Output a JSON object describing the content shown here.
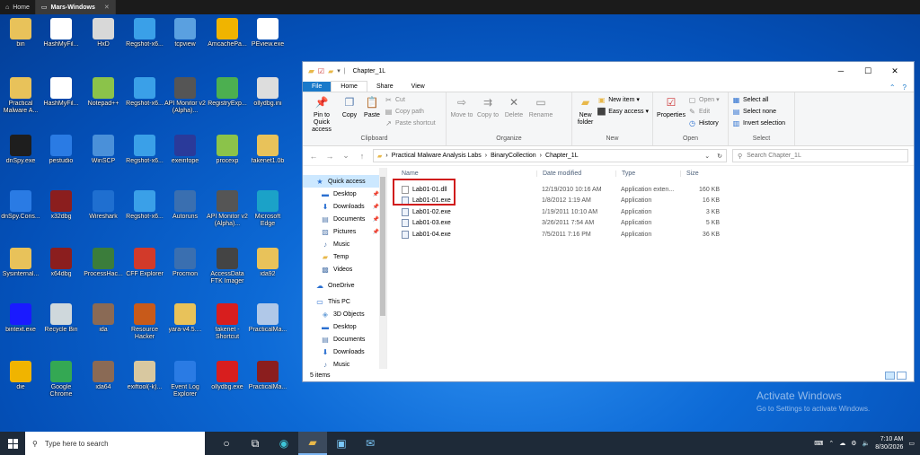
{
  "vm_tabs": [
    {
      "label": "Home"
    },
    {
      "label": "Mars-Windows"
    }
  ],
  "desktop_icons": [
    {
      "label": "bin",
      "icon": "folder-icon",
      "color": "#e8c25a"
    },
    {
      "label": "HashMyFil...",
      "icon": "document-icon",
      "color": "#ffffff"
    },
    {
      "label": "HxD",
      "icon": "hxd-icon",
      "color": "#d8d8d8"
    },
    {
      "label": "Regshot-x6...",
      "icon": "regshot-icon",
      "color": "#3aa0e8"
    },
    {
      "label": "tcpview",
      "icon": "tcpview-icon",
      "color": "#5aa0e0"
    },
    {
      "label": "AmcachePa...",
      "icon": "gear-icon",
      "color": "#f0b400"
    },
    {
      "label": "PEview.exe",
      "icon": "magnifier-icon",
      "color": "#ffffff"
    },
    {
      "label": "Practical Malware A...",
      "icon": "folder-icon",
      "color": "#e8c25a"
    },
    {
      "label": "HashMyFil...",
      "icon": "document-icon",
      "color": "#ffffff"
    },
    {
      "label": "Notepad++",
      "icon": "notepad-icon",
      "color": "#8bc34a"
    },
    {
      "label": "Regshot-x6...",
      "icon": "regshot-icon",
      "color": "#3aa0e8"
    },
    {
      "label": "API Monitor v2 (Alpha)...",
      "icon": "api-monitor-icon",
      "color": "#555555"
    },
    {
      "label": "RegistryExp...",
      "icon": "cube-icon",
      "color": "#4caf50"
    },
    {
      "label": "ollydbg.ini",
      "icon": "settings-file-icon",
      "color": "#dddddd"
    },
    {
      "label": "dnSpy.exe",
      "icon": "dnspy-icon",
      "color": "#1e1e1e"
    },
    {
      "label": "pestudio",
      "icon": "check-icon",
      "color": "#2a7be4"
    },
    {
      "label": "WinSCP",
      "icon": "winscp-icon",
      "color": "#4a90d9"
    },
    {
      "label": "Regshot-x6...",
      "icon": "regshot-icon",
      "color": "#3aa0e8"
    },
    {
      "label": "exeinfope",
      "icon": "exeinfo-icon",
      "color": "#2a3a9a"
    },
    {
      "label": "procexp",
      "icon": "procexp-icon",
      "color": "#8bc34a"
    },
    {
      "label": "fakenet1.0b",
      "icon": "folder-icon",
      "color": "#e8c25a"
    },
    {
      "label": "dnSpy.Cons...",
      "icon": "window-icon",
      "color": "#2a7be4"
    },
    {
      "label": "x32dbg",
      "icon": "bug-icon",
      "color": "#8b1e1e"
    },
    {
      "label": "Wireshark",
      "icon": "wireshark-icon",
      "color": "#1f6fd0"
    },
    {
      "label": "Regshot-x6...",
      "icon": "regshot-icon",
      "color": "#3aa0e8"
    },
    {
      "label": "Autoruns",
      "icon": "autoruns-icon",
      "color": "#3a6fb0"
    },
    {
      "label": "API Monitor v2 (Alpha)...",
      "icon": "api-monitor-icon",
      "color": "#555555"
    },
    {
      "label": "Microsoft Edge",
      "icon": "edge-icon",
      "color": "#1ba2c8"
    },
    {
      "label": "Sysinternal...",
      "icon": "folder-icon",
      "color": "#e8c25a"
    },
    {
      "label": "x64dbg",
      "icon": "bug-icon",
      "color": "#8b1e1e"
    },
    {
      "label": "ProcessHac...",
      "icon": "process-hacker-icon",
      "color": "#3b7d3b"
    },
    {
      "label": "CFF Explorer",
      "icon": "cff-icon",
      "color": "#d23a2a"
    },
    {
      "label": "Procmon",
      "icon": "procmon-icon",
      "color": "#3a6fb0"
    },
    {
      "label": "AccessData FTK Imager",
      "icon": "ftk-icon",
      "color": "#444444"
    },
    {
      "label": "ida92",
      "icon": "folder-icon",
      "color": "#e8c25a"
    },
    {
      "label": "bintext.exe",
      "icon": "bintext-icon",
      "color": "#1a1aff"
    },
    {
      "label": "Recycle Bin",
      "icon": "recycle-bin-icon",
      "color": "#cfd8dc"
    },
    {
      "label": "ida",
      "icon": "ida-icon",
      "color": "#8a6a55"
    },
    {
      "label": "Resource Hacker",
      "icon": "resource-hacker-icon",
      "color": "#c85a1a"
    },
    {
      "label": "yara-v4.5....",
      "icon": "folder-icon",
      "color": "#e8c25a"
    },
    {
      "label": "fakenet - Shortcut",
      "icon": "fakenet-icon",
      "color": "#d81e1e"
    },
    {
      "label": "PracticalMa...",
      "icon": "window-icon",
      "color": "#b0c8e8"
    },
    {
      "label": "die",
      "icon": "die-icon",
      "color": "#f0b400"
    },
    {
      "label": "Google Chrome",
      "icon": "chrome-icon",
      "color": "#34a853"
    },
    {
      "label": "ida64",
      "icon": "ida-icon",
      "color": "#8a6a55"
    },
    {
      "label": "exiftool(-k)...",
      "icon": "exiftool-icon",
      "color": "#d8c8a0"
    },
    {
      "label": "Event Log Explorer",
      "icon": "event-log-icon",
      "color": "#2a7be4"
    },
    {
      "label": "ollydbg.exe",
      "icon": "ollydbg-icon",
      "color": "#d81e1e"
    },
    {
      "label": "PracticalMa...",
      "icon": "book-icon",
      "color": "#8b1e1e"
    }
  ],
  "explorer": {
    "title": "Chapter_1L",
    "ribbon_tabs": [
      "File",
      "Home",
      "Share",
      "View"
    ],
    "groups": {
      "clipboard": {
        "name": "Clipboard",
        "pin": "Pin to Quick access",
        "copy": "Copy",
        "paste": "Paste",
        "cut": "Cut",
        "copy_path": "Copy path",
        "paste_shortcut": "Paste shortcut"
      },
      "organize": {
        "name": "Organize",
        "move_to": "Move to",
        "copy_to": "Copy to",
        "delete": "Delete",
        "rename": "Rename"
      },
      "new": {
        "name": "New",
        "new_folder": "New folder",
        "new_item": "New item ▾",
        "easy_access": "Easy access ▾"
      },
      "open": {
        "name": "Open",
        "properties": "Properties",
        "open": "Open ▾",
        "edit": "Edit",
        "history": "History"
      },
      "select": {
        "name": "Select",
        "select_all": "Select all",
        "select_none": "Select none",
        "invert": "Invert selection"
      }
    },
    "breadcrumb": [
      "Practical Malware Analysis Labs",
      "BinaryCollection",
      "Chapter_1L"
    ],
    "search_placeholder": "Search Chapter_1L",
    "nav_items": [
      {
        "label": "Quick access",
        "icon": "star-icon",
        "pinned": false
      },
      {
        "label": "Desktop",
        "icon": "desktop-icon",
        "pinned": true
      },
      {
        "label": "Downloads",
        "icon": "download-icon",
        "pinned": true
      },
      {
        "label": "Documents",
        "icon": "documents-icon",
        "pinned": true
      },
      {
        "label": "Pictures",
        "icon": "pictures-icon",
        "pinned": true
      },
      {
        "label": "Music",
        "icon": "music-icon",
        "pinned": false
      },
      {
        "label": "Temp",
        "icon": "folder-icon",
        "pinned": false
      },
      {
        "label": "Videos",
        "icon": "videos-icon",
        "pinned": false
      },
      {
        "label": "OneDrive",
        "icon": "cloud-icon",
        "pinned": false
      },
      {
        "label": "This PC",
        "icon": "pc-icon",
        "pinned": false
      },
      {
        "label": "3D Objects",
        "icon": "cube-icon",
        "pinned": false
      },
      {
        "label": "Desktop",
        "icon": "desktop-icon",
        "pinned": false
      },
      {
        "label": "Documents",
        "icon": "documents-icon",
        "pinned": false
      },
      {
        "label": "Downloads",
        "icon": "download-icon",
        "pinned": false
      },
      {
        "label": "Music",
        "icon": "music-icon",
        "pinned": false
      }
    ],
    "columns": {
      "name": "Name",
      "date": "Date modified",
      "type": "Type",
      "size": "Size"
    },
    "files": [
      {
        "name": "Lab01-01.dll",
        "date": "12/19/2010 10:16 AM",
        "type": "Application exten...",
        "size": "160 KB",
        "kind": "dll"
      },
      {
        "name": "Lab01-01.exe",
        "date": "1/8/2012 1:19 AM",
        "type": "Application",
        "size": "16 KB",
        "kind": "exe"
      },
      {
        "name": "Lab01-02.exe",
        "date": "1/19/2011 10:10 AM",
        "type": "Application",
        "size": "3 KB",
        "kind": "exe"
      },
      {
        "name": "Lab01-03.exe",
        "date": "3/26/2011 7:54 AM",
        "type": "Application",
        "size": "5 KB",
        "kind": "exe"
      },
      {
        "name": "Lab01-04.exe",
        "date": "7/5/2011 7:16 PM",
        "type": "Application",
        "size": "36 KB",
        "kind": "exe"
      }
    ],
    "status": "5 items"
  },
  "watermark": {
    "line1": "Activate Windows",
    "line2": "Go to Settings to activate Windows."
  },
  "taskbar": {
    "search_placeholder": "Type here to search",
    "time": "7:10 AM",
    "date": "8/30/2026"
  },
  "colors": {
    "accent": "#1979ca",
    "highlight_box": "#d01c1c",
    "taskbar": "#1e2a38"
  }
}
